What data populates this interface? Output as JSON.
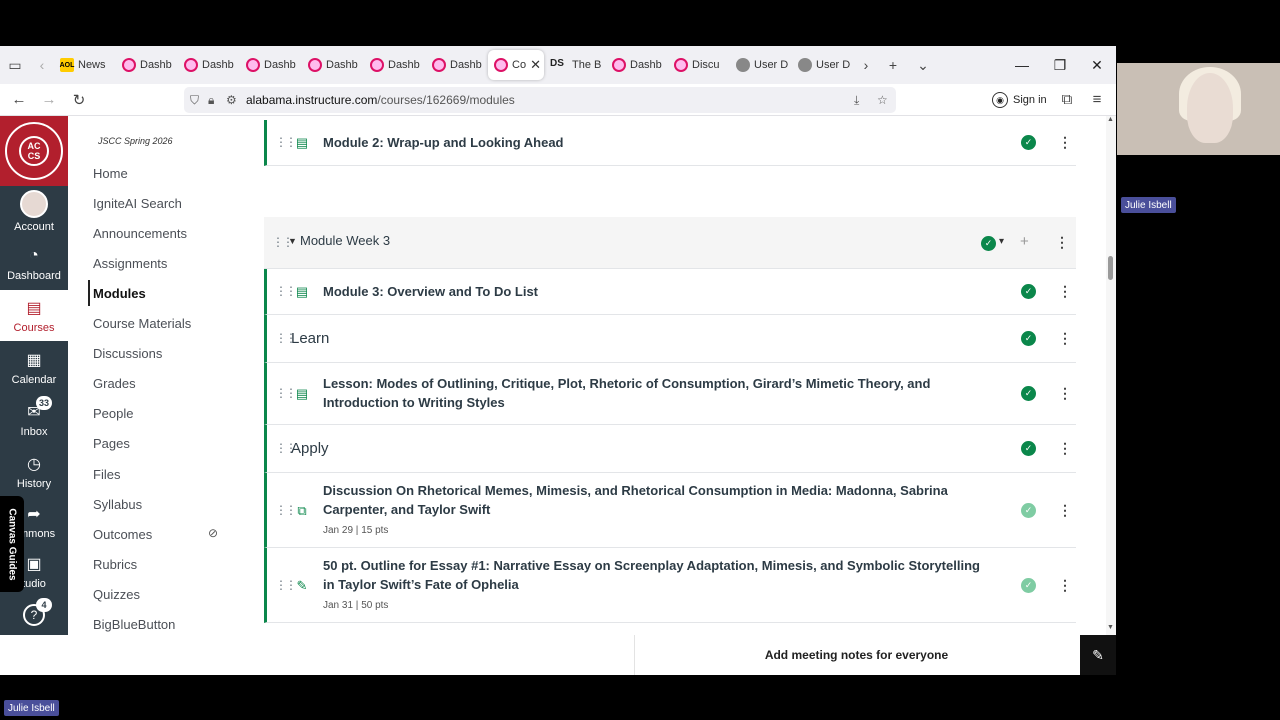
{
  "browser": {
    "tabs": [
      {
        "label": "News",
        "fav": "aol",
        "fav_text": "AOL"
      },
      {
        "label": "Dashb",
        "fav": "canvas"
      },
      {
        "label": "Dashb",
        "fav": "canvas"
      },
      {
        "label": "Dashb",
        "fav": "canvas"
      },
      {
        "label": "Dashb",
        "fav": "canvas"
      },
      {
        "label": "Dashb",
        "fav": "canvas"
      },
      {
        "label": "Dashb",
        "fav": "canvas"
      },
      {
        "label": "Co",
        "fav": "canvas",
        "active": true
      },
      {
        "label": "The B",
        "fav": "ds",
        "fav_text": "DS"
      },
      {
        "label": "Dashb",
        "fav": "canvas"
      },
      {
        "label": "Discu",
        "fav": "canvas"
      },
      {
        "label": "User D",
        "fav": "user"
      },
      {
        "label": "User D",
        "fav": "user"
      }
    ],
    "url_host": "alabama.instructure.com",
    "url_path": "/courses/162669/modules",
    "sign_in": "Sign in"
  },
  "global_nav": {
    "logo_text": "AC CS",
    "items": [
      {
        "label": "Account",
        "icon": "avatar"
      },
      {
        "label": "Dashboard",
        "icon": "dashboard-icon"
      },
      {
        "label": "Courses",
        "icon": "courses-icon",
        "active": true
      },
      {
        "label": "Calendar",
        "icon": "calendar-icon"
      },
      {
        "label": "Inbox",
        "icon": "inbox-icon",
        "badge": "33"
      },
      {
        "label": "History",
        "icon": "history-icon"
      },
      {
        "label": "ommons",
        "icon": "commons-icon"
      },
      {
        "label": "tudio",
        "icon": "studio-icon"
      },
      {
        "label": "",
        "icon": "help-icon",
        "badge": "4"
      }
    ],
    "guides_label": "Canvas Guides"
  },
  "course_nav": {
    "term": "JSCC Spring 2026",
    "items": [
      "Home",
      "IgniteAI Search",
      "Announcements",
      "Assignments",
      "Modules",
      "Course Materials",
      "Discussions",
      "Grades",
      "People",
      "Pages",
      "Files",
      "Syllabus",
      "Outcomes",
      "Rubrics",
      "Quizzes",
      "BigBlueButton"
    ],
    "active": "Modules"
  },
  "modules": {
    "top_item": "Module 2: Wrap-up and Looking Ahead",
    "week3_header": "Module Week 3",
    "items": [
      {
        "kind": "page",
        "title": "Module 3: Overview and To Do List"
      },
      {
        "kind": "subheader",
        "title": "Learn"
      },
      {
        "kind": "page",
        "title": "Lesson: Modes of Outlining, Critique, Plot, Rhetoric of Consumption, Girard’s Mimetic Theory, and Introduction to Writing Styles"
      },
      {
        "kind": "subheader",
        "title": "Apply"
      },
      {
        "kind": "discussion",
        "title": "Discussion On Rhetorical Memes, Mimesis, and Rhetorical Consumption in Media: Madonna, Sabrina Carpenter, and Taylor Swift",
        "date": "Jan 29",
        "pts": "15 pts"
      },
      {
        "kind": "assignment",
        "title": "50 pt. Outline for Essay #1: Narrative Essay on Screenplay Adaptation, Mimesis, and Symbolic Storytelling in Taylor Swift’s Fate of Ophelia",
        "date": "Jan 31",
        "pts": "50 pts"
      }
    ]
  },
  "meeting": {
    "notes_label": "Add meeting notes for everyone",
    "participant_name": "Julie Isbell",
    "self_name": "Julie Isbell"
  },
  "colors": {
    "canvas_red": "#b21f2d",
    "nav_dark": "#2d3b45",
    "published_green": "#0b874b"
  }
}
